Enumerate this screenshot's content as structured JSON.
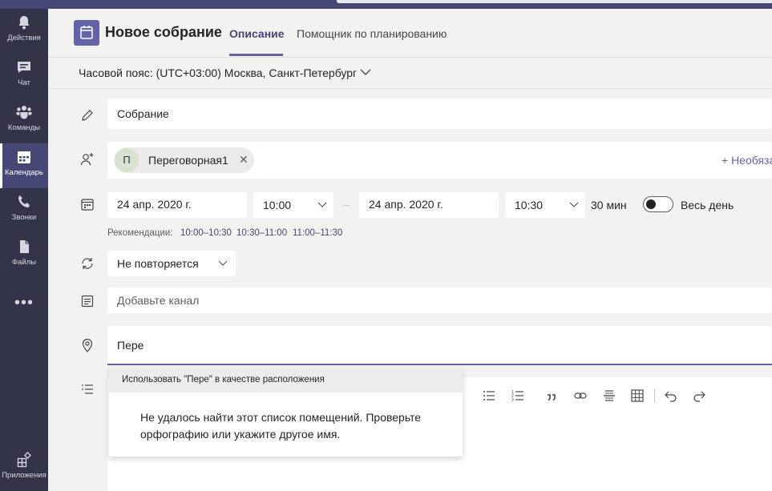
{
  "rail": {
    "items": [
      {
        "label": "Действия",
        "icon": "bell-icon"
      },
      {
        "label": "Чат",
        "icon": "chat-icon"
      },
      {
        "label": "Команды",
        "icon": "teams-icon"
      },
      {
        "label": "Календарь",
        "icon": "calendar-icon"
      },
      {
        "label": "Звонки",
        "icon": "phone-icon"
      },
      {
        "label": "Файлы",
        "icon": "file-icon"
      }
    ],
    "more": "•••",
    "apps": {
      "label": "Приложения",
      "icon": "apps-icon"
    }
  },
  "header": {
    "title": "Новое собрание",
    "tabs": [
      {
        "label": "Описание",
        "active": true
      },
      {
        "label": "Помощник по планированию",
        "active": false
      }
    ]
  },
  "timezone": {
    "label": "Часовой пояс: (UTC+03:00) Москва, Санкт-Петербург"
  },
  "form": {
    "title_value": "Собрание",
    "attendee": {
      "initial": "П",
      "name": "Переговорная1",
      "remove": "✕"
    },
    "optional_link": "+ Необяза",
    "start_date": "24 апр. 2020 г.",
    "start_time": "10:00",
    "arrow": "→",
    "end_date": "24 апр. 2020 г.",
    "end_time": "10:30",
    "duration": "30 мин",
    "all_day_label": "Весь день",
    "all_day_on": false,
    "recommendations_label": "Рекомендации:",
    "recommendations": [
      "10:00–10:30",
      "10:30–11:00",
      "11:00–11:30"
    ],
    "repeat_value": "Не повторяется",
    "channel_placeholder": "Добавьте канал",
    "location_value": "Пере"
  },
  "location_dropdown": {
    "header": "Использовать \"Пере\" в качестве расположения",
    "message": "Не удалось найти этот список помещений. Проверьте орфографию или укажите другое имя."
  },
  "colors": {
    "accent": "#6264a7",
    "rail": "#33344a",
    "rail_active": "#464775",
    "background": "#f3f2f1"
  }
}
